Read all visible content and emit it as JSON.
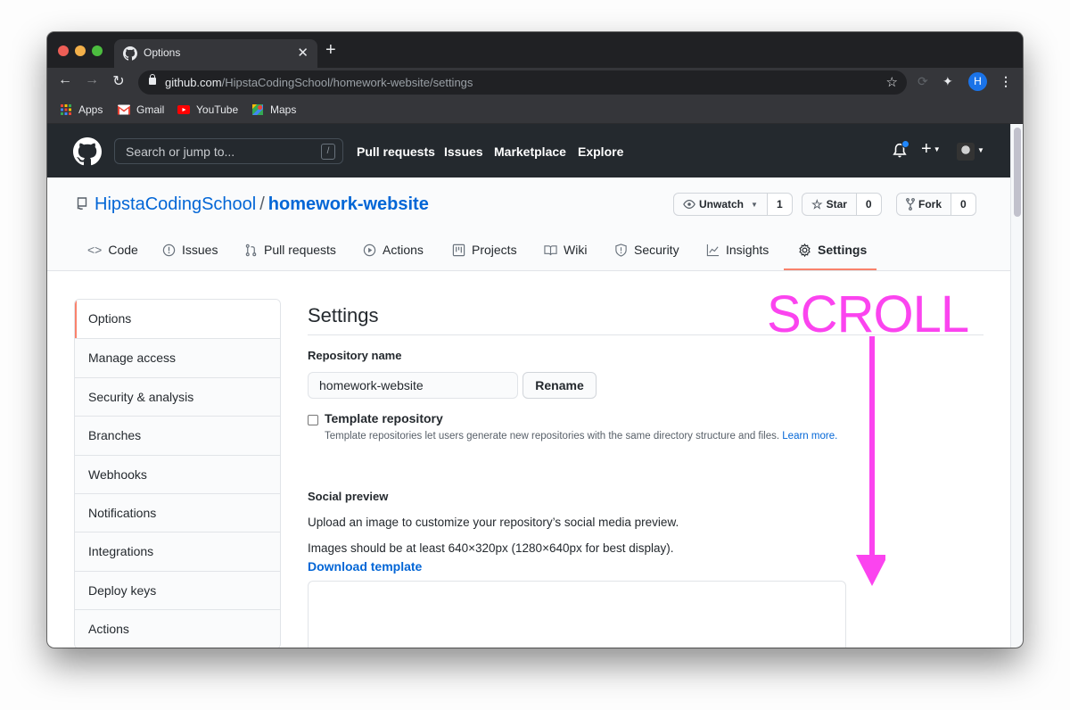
{
  "browser": {
    "tab": {
      "title": "Options",
      "icon": "github-icon"
    },
    "new_tab_label": "+",
    "url_host": "github.com",
    "url_path": "/HipstaCodingSchool/homework-website/settings",
    "profile_initial": "H",
    "bookmarks": [
      {
        "label": "Apps",
        "icon": "apps-grid-icon"
      },
      {
        "label": "Gmail",
        "icon": "gmail-icon"
      },
      {
        "label": "YouTube",
        "icon": "youtube-icon"
      },
      {
        "label": "Maps",
        "icon": "maps-icon"
      }
    ]
  },
  "github_header": {
    "search_placeholder": "Search or jump to...",
    "search_shortcut": "/",
    "nav": [
      "Pull requests",
      "Issues",
      "Marketplace",
      "Explore"
    ],
    "has_notification": true
  },
  "repo": {
    "owner": "HipstaCodingSchool",
    "separator": "/",
    "name": "homework-website",
    "actions": [
      {
        "label": "Unwatch",
        "count": "1",
        "icon": "eye-icon",
        "has_dropdown": true
      },
      {
        "label": "Star",
        "count": "0",
        "icon": "star-icon"
      },
      {
        "label": "Fork",
        "count": "0",
        "icon": "fork-icon"
      }
    ],
    "tabs": [
      {
        "label": "Code",
        "icon": "code-icon"
      },
      {
        "label": "Issues",
        "icon": "issue-icon"
      },
      {
        "label": "Pull requests",
        "icon": "pull-request-icon"
      },
      {
        "label": "Actions",
        "icon": "play-icon"
      },
      {
        "label": "Projects",
        "icon": "project-icon"
      },
      {
        "label": "Wiki",
        "icon": "book-icon"
      },
      {
        "label": "Security",
        "icon": "shield-icon"
      },
      {
        "label": "Insights",
        "icon": "graph-icon"
      },
      {
        "label": "Settings",
        "icon": "gear-icon",
        "selected": true
      }
    ]
  },
  "sidebar": {
    "items": [
      {
        "label": "Options",
        "active": true
      },
      {
        "label": "Manage access"
      },
      {
        "label": "Security & analysis"
      },
      {
        "label": "Branches"
      },
      {
        "label": "Webhooks"
      },
      {
        "label": "Notifications"
      },
      {
        "label": "Integrations"
      },
      {
        "label": "Deploy keys"
      },
      {
        "label": "Actions"
      }
    ]
  },
  "settings": {
    "title": "Settings",
    "repo_name_label": "Repository name",
    "repo_name_value": "homework-website",
    "rename_button": "Rename",
    "template_checkbox_label": "Template repository",
    "template_checked": false,
    "template_note": "Template repositories let users generate new repositories with the same directory structure and files.",
    "learn_more": "Learn more.",
    "social_preview_label": "Social preview",
    "social_preview_desc": "Upload an image to customize your repository’s social media preview.",
    "social_preview_size": "Images should be at least 640×320px (1280×640px for best display).",
    "download_template": "Download template"
  },
  "annotation": {
    "text": "SCROLL",
    "color": "#fb44ef"
  },
  "colors": {
    "link": "#0366d6",
    "selected_underline": "#f9826c",
    "header_bg": "#24292e"
  }
}
